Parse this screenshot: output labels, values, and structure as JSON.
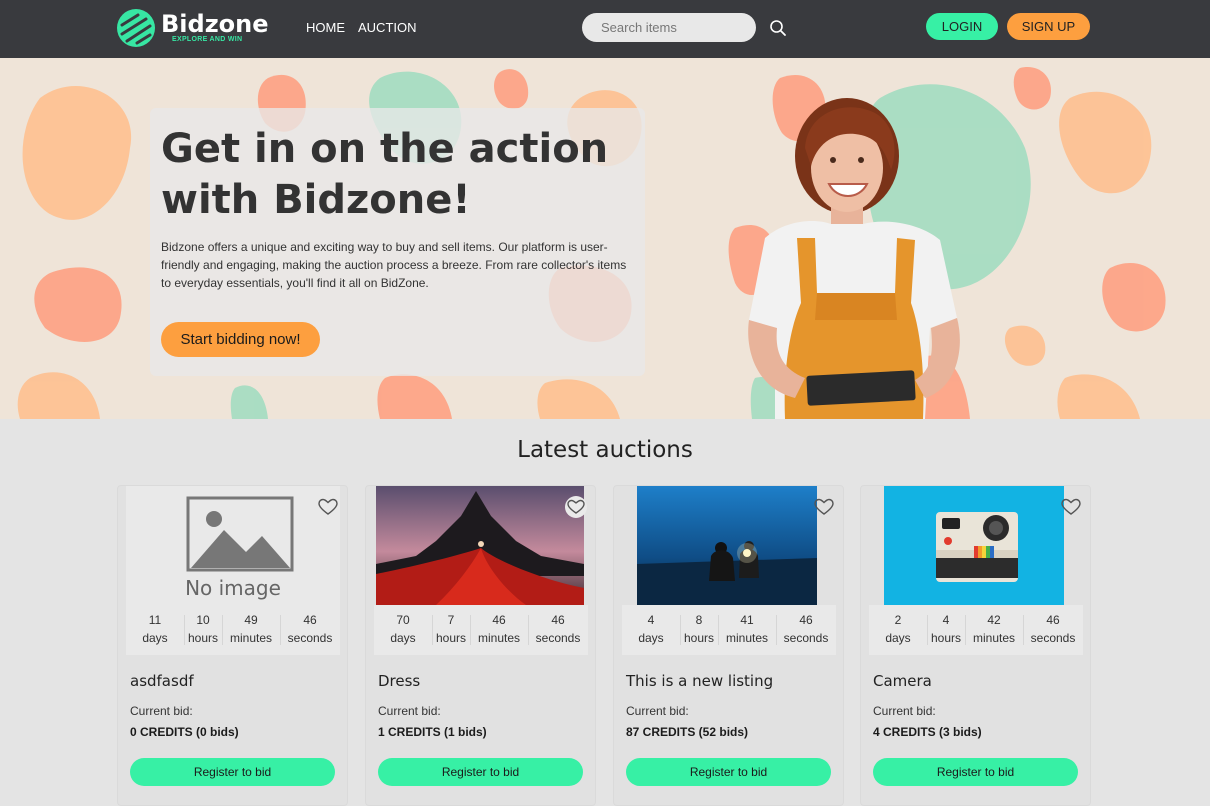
{
  "brand": {
    "name": "Bidzone",
    "tagline": "EXPLORE AND WIN"
  },
  "nav": {
    "links": [
      "HOME",
      "AUCTION"
    ],
    "search_placeholder": "Search items",
    "login_label": "LOGIN",
    "signup_label": "SIGN UP"
  },
  "hero": {
    "title": "Get in on the action with Bidzone!",
    "text": "Bidzone offers a unique and exciting way to buy and sell items. Our platform is user-friendly and engaging, making the auction process a breeze. From rare collector's items to everyday essentials, you'll find it all on BidZone.",
    "cta_label": "Start bidding now!"
  },
  "auctions": {
    "title": "Latest auctions",
    "items": [
      {
        "title": "asdfasdf",
        "image": "no-image",
        "no_image_text": "No image",
        "timer": [
          {
            "value": "11",
            "unit": "days"
          },
          {
            "value": "10",
            "unit": "hours"
          },
          {
            "value": "49",
            "unit": "minutes"
          },
          {
            "value": "46",
            "unit": "seconds"
          }
        ],
        "bid_label": "Current bid:",
        "bid_value": "0 CREDITS (0 bids)",
        "button_label": "Register to bid"
      },
      {
        "title": "Dress",
        "image": "dress-photo",
        "timer": [
          {
            "value": "70",
            "unit": "days"
          },
          {
            "value": "7",
            "unit": "hours"
          },
          {
            "value": "46",
            "unit": "minutes"
          },
          {
            "value": "46",
            "unit": "seconds"
          }
        ],
        "bid_label": "Current bid:",
        "bid_value": "1 CREDITS (1 bids)",
        "button_label": "Register to bid"
      },
      {
        "title": "This is a new listing",
        "image": "night-photo",
        "timer": [
          {
            "value": "4",
            "unit": "days"
          },
          {
            "value": "8",
            "unit": "hours"
          },
          {
            "value": "41",
            "unit": "minutes"
          },
          {
            "value": "46",
            "unit": "seconds"
          }
        ],
        "bid_label": "Current bid:",
        "bid_value": "87 CREDITS (52 bids)",
        "button_label": "Register to bid"
      },
      {
        "title": "Camera",
        "image": "camera-photo",
        "timer": [
          {
            "value": "2",
            "unit": "days"
          },
          {
            "value": "4",
            "unit": "hours"
          },
          {
            "value": "42",
            "unit": "minutes"
          },
          {
            "value": "46",
            "unit": "seconds"
          }
        ],
        "bid_label": "Current bid:",
        "bid_value": "4 CREDITS (3 bids)",
        "button_label": "Register to bid"
      }
    ]
  },
  "colors": {
    "nav_bg": "#393a3e",
    "accent_green": "#37f0a5",
    "accent_orange": "#fd9f3f",
    "page_bg": "#e4e4e4"
  }
}
